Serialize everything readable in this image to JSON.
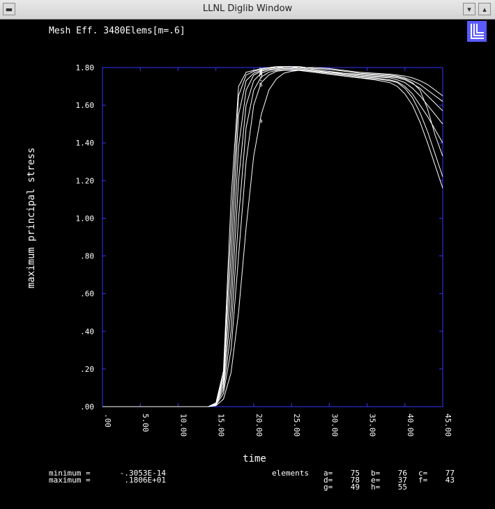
{
  "window": {
    "title": "LLNL Diglib Window"
  },
  "colors": {
    "background": "#000000",
    "axis_frame": "#3535ff",
    "text": "#ffffff",
    "curve": "#ffffff",
    "logo_bg": "#5a5aff"
  },
  "icons": {
    "logo": "llnl-logo-icon"
  },
  "stats": {
    "minimum_label": "minimum =",
    "minimum_value": "-.3053E-14",
    "maximum_label": "maximum =",
    "maximum_value": ".1806E+01",
    "elements_label": "elements",
    "elements": [
      {
        "key": "a=",
        "value": "75"
      },
      {
        "key": "b=",
        "value": "76"
      },
      {
        "key": "c=",
        "value": "77"
      },
      {
        "key": "d=",
        "value": "78"
      },
      {
        "key": "e=",
        "value": "37"
      },
      {
        "key": "f=",
        "value": "43"
      },
      {
        "key": "g=",
        "value": "49"
      },
      {
        "key": "h=",
        "value": "55"
      }
    ]
  },
  "chart_data": {
    "type": "line",
    "title": "Mesh Eff. 3480Elems[m=.6]",
    "xlabel": "time",
    "ylabel": "maximum principal stress",
    "xlim": [
      0,
      45
    ],
    "ylim": [
      0,
      1.8
    ],
    "x_ticks": [
      0,
      5,
      10,
      15,
      20,
      25,
      30,
      35,
      40,
      45
    ],
    "x_tick_labels": [
      ".00",
      "5.00",
      "10.00",
      "15.00",
      "20.00",
      "25.00",
      "30.00",
      "35.00",
      "40.00",
      "45.00"
    ],
    "y_ticks": [
      0,
      0.2,
      0.4,
      0.6,
      0.8,
      1.0,
      1.2,
      1.4,
      1.6,
      1.8
    ],
    "y_tick_labels": [
      ".00",
      ".20",
      ".40",
      ".60",
      ".80",
      "1.00",
      "1.20",
      "1.40",
      "1.60",
      "1.80"
    ],
    "grid": false,
    "series": [
      {
        "marker": "a",
        "marker_x": 21,
        "marker_y": 1.52,
        "x": [
          0,
          13,
          14,
          15,
          16,
          17,
          18,
          19,
          20,
          21,
          22,
          23,
          24,
          25,
          26,
          27,
          28,
          30,
          32,
          34,
          36,
          38,
          39,
          40,
          41,
          42,
          43,
          44,
          45
        ],
        "y": [
          0,
          0,
          0,
          0.005,
          0.04,
          0.18,
          0.5,
          0.95,
          1.33,
          1.55,
          1.68,
          1.74,
          1.77,
          1.78,
          1.785,
          1.785,
          1.78,
          1.775,
          1.77,
          1.765,
          1.76,
          1.755,
          1.75,
          1.74,
          1.72,
          1.68,
          1.58,
          1.44,
          1.33
        ]
      },
      {
        "marker": "b",
        "marker_x": 21,
        "marker_y": 1.71,
        "x": [
          0,
          13,
          14,
          15,
          16,
          17,
          18,
          19,
          20,
          21,
          22,
          23,
          24,
          25,
          26,
          27,
          28,
          30,
          32,
          34,
          36,
          38,
          39,
          40,
          41,
          42,
          43,
          44,
          45
        ],
        "y": [
          0,
          0,
          0,
          0.008,
          0.07,
          0.3,
          0.8,
          1.3,
          1.6,
          1.72,
          1.76,
          1.78,
          1.785,
          1.785,
          1.785,
          1.78,
          1.775,
          1.765,
          1.755,
          1.745,
          1.74,
          1.73,
          1.72,
          1.69,
          1.64,
          1.56,
          1.46,
          1.34,
          1.22
        ]
      },
      {
        "marker": "c",
        "marker_x": 21,
        "marker_y": 1.74,
        "x": [
          0,
          13,
          14,
          15,
          16,
          17,
          18,
          19,
          20,
          21,
          22,
          23,
          24,
          25,
          26,
          27,
          28,
          30,
          32,
          34,
          36,
          38,
          39,
          40,
          41,
          42,
          43,
          44,
          45
        ],
        "y": [
          0,
          0,
          0,
          0.01,
          0.09,
          0.4,
          1.0,
          1.48,
          1.68,
          1.75,
          1.775,
          1.785,
          1.79,
          1.79,
          1.785,
          1.78,
          1.775,
          1.765,
          1.755,
          1.745,
          1.735,
          1.72,
          1.7,
          1.66,
          1.6,
          1.51,
          1.4,
          1.28,
          1.16
        ]
      },
      {
        "marker": "d",
        "marker_x": 21,
        "marker_y": 1.76,
        "x": [
          0,
          13,
          14,
          15,
          16,
          17,
          18,
          19,
          20,
          21,
          22,
          23,
          24,
          25,
          26,
          27,
          28,
          30,
          32,
          34,
          36,
          38,
          39,
          40,
          41,
          42,
          43,
          44,
          45
        ],
        "y": [
          0,
          0,
          0,
          0.012,
          0.11,
          0.52,
          1.2,
          1.6,
          1.73,
          1.77,
          1.785,
          1.79,
          1.795,
          1.795,
          1.79,
          1.785,
          1.78,
          1.77,
          1.76,
          1.75,
          1.745,
          1.735,
          1.725,
          1.7,
          1.66,
          1.6,
          1.54,
          1.47,
          1.4
        ]
      },
      {
        "marker": "e",
        "marker_x": 21,
        "marker_y": 1.77,
        "x": [
          0,
          13,
          14,
          15,
          16,
          17,
          18,
          19,
          20,
          21,
          22,
          23,
          24,
          25,
          26,
          27,
          28,
          30,
          32,
          34,
          36,
          38,
          39,
          40,
          41,
          42,
          43,
          44,
          45
        ],
        "y": [
          0,
          0,
          0,
          0.014,
          0.13,
          0.65,
          1.38,
          1.68,
          1.76,
          1.78,
          1.79,
          1.795,
          1.8,
          1.8,
          1.795,
          1.79,
          1.785,
          1.775,
          1.765,
          1.755,
          1.75,
          1.745,
          1.735,
          1.72,
          1.69,
          1.65,
          1.6,
          1.55,
          1.5
        ]
      },
      {
        "marker": "f",
        "marker_x": 21,
        "marker_y": 1.78,
        "x": [
          0,
          13,
          14,
          15,
          16,
          17,
          18,
          19,
          20,
          21,
          22,
          23,
          24,
          25,
          26,
          27,
          28,
          30,
          32,
          34,
          36,
          38,
          39,
          40,
          41,
          42,
          43,
          44,
          45
        ],
        "y": [
          0,
          0,
          0,
          0.016,
          0.15,
          0.8,
          1.55,
          1.73,
          1.77,
          1.785,
          1.795,
          1.8,
          1.8,
          1.8,
          1.8,
          1.795,
          1.79,
          1.78,
          1.77,
          1.76,
          1.755,
          1.75,
          1.745,
          1.735,
          1.715,
          1.69,
          1.65,
          1.61,
          1.57
        ]
      },
      {
        "marker": "g",
        "marker_x": 21,
        "marker_y": 1.785,
        "x": [
          0,
          13,
          14,
          15,
          16,
          17,
          18,
          19,
          20,
          21,
          22,
          23,
          24,
          25,
          26,
          27,
          28,
          30,
          32,
          34,
          36,
          38,
          39,
          40,
          41,
          42,
          43,
          44,
          45
        ],
        "y": [
          0,
          0,
          0,
          0.018,
          0.17,
          0.95,
          1.65,
          1.76,
          1.78,
          1.79,
          1.8,
          1.8,
          1.805,
          1.805,
          1.8,
          1.8,
          1.795,
          1.79,
          1.78,
          1.77,
          1.765,
          1.76,
          1.755,
          1.745,
          1.73,
          1.71,
          1.68,
          1.65,
          1.62
        ]
      },
      {
        "marker": "h",
        "marker_x": 21,
        "marker_y": 1.79,
        "x": [
          0,
          13,
          14,
          15,
          16,
          17,
          18,
          19,
          20,
          21,
          22,
          23,
          24,
          25,
          26,
          27,
          28,
          30,
          32,
          34,
          36,
          38,
          39,
          40,
          41,
          42,
          43,
          44,
          45
        ],
        "y": [
          0,
          0,
          0,
          0.02,
          0.19,
          1.1,
          1.7,
          1.775,
          1.785,
          1.795,
          1.8,
          1.805,
          1.805,
          1.805,
          1.805,
          1.8,
          1.8,
          1.795,
          1.785,
          1.775,
          1.77,
          1.765,
          1.76,
          1.755,
          1.745,
          1.73,
          1.71,
          1.68,
          1.65
        ]
      }
    ]
  }
}
